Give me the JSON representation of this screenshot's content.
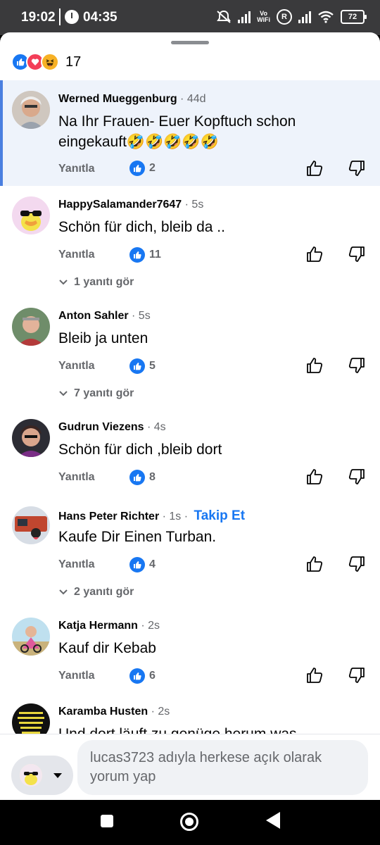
{
  "status_bar": {
    "time": "19:02",
    "timer": "04:35",
    "vowifi": [
      "Vo",
      "WiFi"
    ],
    "roaming": "R",
    "battery": "72"
  },
  "reactions": {
    "icons": [
      "like-icon",
      "love-icon",
      "haha-icon"
    ],
    "count": "17"
  },
  "comments": [
    {
      "author": "Werned Mueggenburg",
      "time": "· 44d",
      "text": "Na Ihr Frauen- Euer Kopftuch schon eingekauft🤣🤣🤣🤣🤣",
      "reply_label": "Yanıtla",
      "likes": "2",
      "highlighted": true
    },
    {
      "author": "HappySalamander7647",
      "time": "· 5s",
      "text": "Schön für dich,  bleib da ..",
      "reply_label": "Yanıtla",
      "likes": "11",
      "more_replies": "1 yanıtı gör"
    },
    {
      "author": "Anton Sahler",
      "time": "· 5s",
      "text": "Bleib ja unten",
      "reply_label": "Yanıtla",
      "likes": "5",
      "more_replies": "7 yanıtı gör"
    },
    {
      "author": "Gudrun Viezens",
      "time": "· 4s",
      "text": "Schön für dich ,bleib dort",
      "reply_label": "Yanıtla",
      "likes": "8"
    },
    {
      "author": "Hans Peter Richter",
      "time": "· 1s ·",
      "follow": "Takip Et",
      "text": "Kaufe Dir Einen Turban.",
      "reply_label": "Yanıtla",
      "likes": "4",
      "more_replies": "2 yanıtı gör"
    },
    {
      "author": "Katja Hermann",
      "time": "· 2s",
      "text": "Kauf dir Kebab",
      "reply_label": "Yanıtla",
      "likes": "6"
    },
    {
      "author": "Karamba Husten",
      "time": "· 2s",
      "text": "Und dort läuft zu genüge herum was"
    }
  ],
  "composer": {
    "placeholder": "lucas3723 adıyla herkese açık olarak yorum yap"
  },
  "colors": {
    "accent": "#1877f2",
    "highlight_bg": "#eef3fb",
    "highlight_border": "#4a7fe0",
    "muted": "#65676b"
  }
}
